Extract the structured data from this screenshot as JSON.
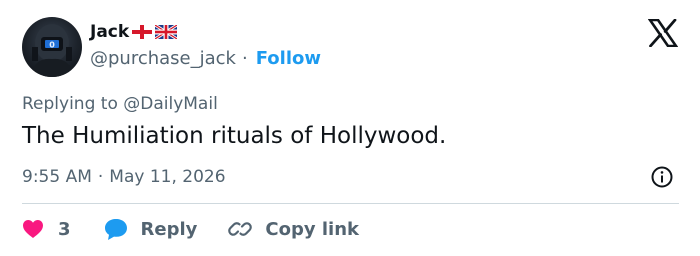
{
  "author": {
    "name": "Jack",
    "handle": "@purchase_jack",
    "separator": "·",
    "follow_label": "Follow"
  },
  "icons": {
    "platform": "x-logo-icon",
    "flag_1": "england-flag-icon",
    "flag_2": "union-jack-flag-icon",
    "info": "info-icon",
    "like": "heart-icon",
    "reply": "speech-bubble-icon",
    "copy": "link-icon"
  },
  "tweet": {
    "replying_prefix": "Replying to ",
    "replying_handle": "@DailyMail",
    "text": "The Humiliation rituals of Hollywood.",
    "time": "9:55 AM",
    "separator": "·",
    "date": "May 11, 2026"
  },
  "actions": {
    "like_count": "3",
    "reply_label": "Reply",
    "copy_label": "Copy link"
  },
  "colors": {
    "link": "#1d9bf0",
    "like": "#f91880",
    "reply": "#1d9bf0",
    "secondary_text": "#536471",
    "divider": "#cfd9de"
  }
}
